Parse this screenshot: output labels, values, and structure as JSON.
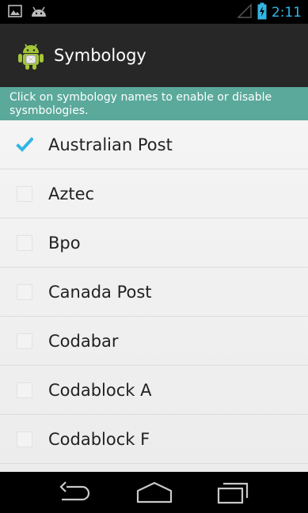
{
  "status_bar": {
    "time": "2:11",
    "left_icons": [
      "image-icon",
      "android-icon"
    ],
    "right_icons": [
      "signal-icon",
      "battery-icon"
    ]
  },
  "action_bar": {
    "title": "Symbology",
    "icon": "app-android-icon"
  },
  "hint": {
    "text": "Click on symbology names to enable or disable sysmbologies."
  },
  "symbologies": [
    {
      "label": "Australian Post",
      "checked": true
    },
    {
      "label": "Aztec",
      "checked": false
    },
    {
      "label": "Bpo",
      "checked": false
    },
    {
      "label": "Canada Post",
      "checked": false
    },
    {
      "label": "Codabar",
      "checked": false
    },
    {
      "label": "Codablock A",
      "checked": false
    },
    {
      "label": "Codablock F",
      "checked": false
    }
  ],
  "nav_bar": {
    "buttons": [
      "back-icon",
      "home-icon",
      "recents-icon"
    ]
  },
  "colors": {
    "accent": "#33b5e5",
    "hint_bg": "#5aa99b",
    "action_bar_bg": "#272727"
  }
}
